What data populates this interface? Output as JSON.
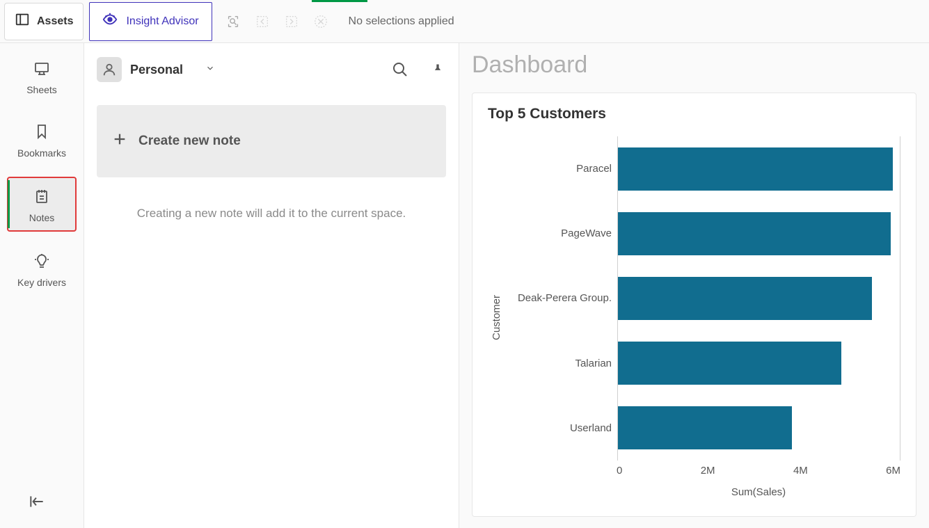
{
  "topbar": {
    "assets_label": "Assets",
    "insight_label": "Insight Advisor",
    "no_selections": "No selections applied"
  },
  "sidebar": {
    "sheets": "Sheets",
    "bookmarks": "Bookmarks",
    "notes": "Notes",
    "keydrivers": "Key drivers"
  },
  "panel": {
    "personal": "Personal",
    "create_note": "Create new note",
    "helper": "Creating a new note will add it to the current space."
  },
  "dashboard": {
    "title": "Dashboard"
  },
  "chart_data": {
    "type": "bar",
    "orientation": "horizontal",
    "title": "Top 5 Customers",
    "ylabel": "Customer",
    "xlabel": "Sum(Sales)",
    "xlim": [
      0,
      6000000
    ],
    "xticks": [
      "0",
      "2M",
      "4M",
      "6M"
    ],
    "categories": [
      "Paracel",
      "PageWave",
      "Deak-Perera Group.",
      "Talarian",
      "Userland"
    ],
    "values": [
      5850000,
      5800000,
      5400000,
      4750000,
      3700000
    ],
    "bar_color": "#116d8f"
  }
}
